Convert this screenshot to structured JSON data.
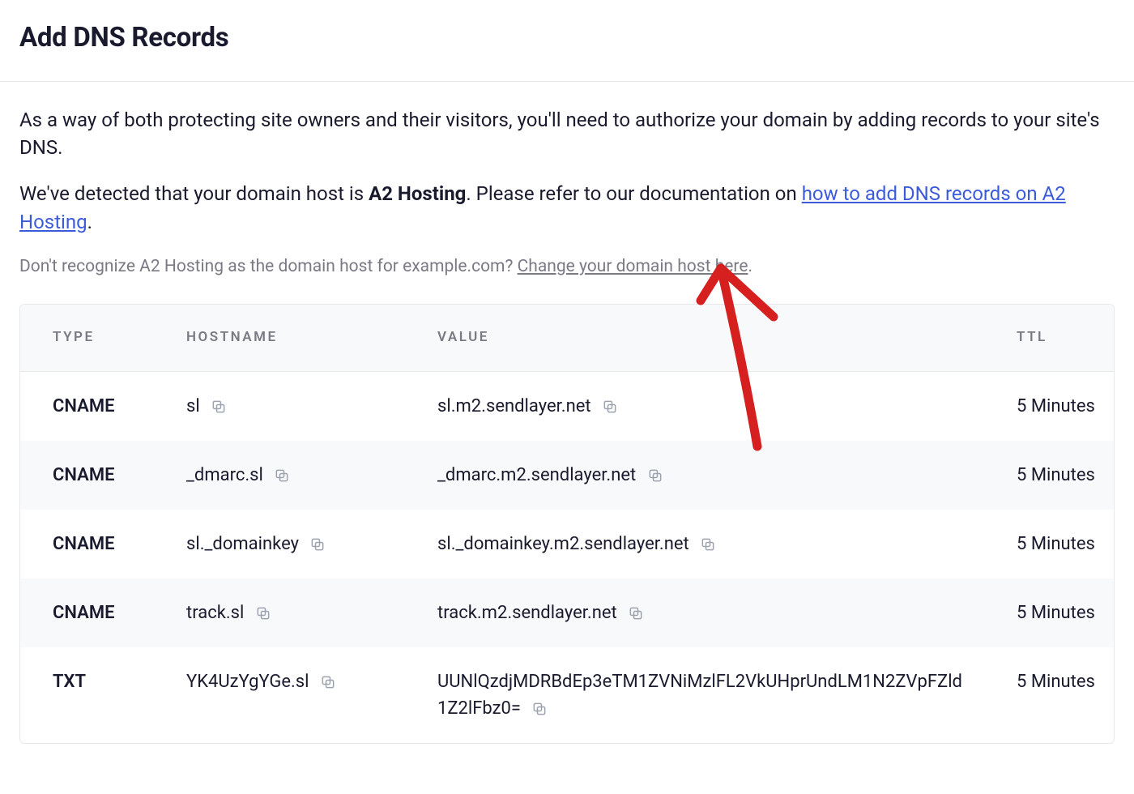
{
  "page": {
    "title": "Add DNS Records"
  },
  "intro": {
    "p1": "As a way of both protecting site owners and their visitors, you'll need to authorize your domain by adding records to your site's DNS.",
    "p2_prefix": "We've detected that your domain host is ",
    "p2_host": "A2 Hosting",
    "p2_mid": ". Please refer to our documentation on ",
    "p2_link": "how to add DNS records on A2 Hosting",
    "p2_suffix": ".",
    "unrecognized_prefix": "Don't recognize A2 Hosting as the domain host for example.com? ",
    "unrecognized_link": "Change your domain host here",
    "unrecognized_suffix": "."
  },
  "table": {
    "headers": {
      "type": "TYPE",
      "hostname": "HOSTNAME",
      "value": "VALUE",
      "ttl": "TTL"
    },
    "rows": [
      {
        "type": "CNAME",
        "hostname": "sl",
        "value": "sl.m2.sendlayer.net",
        "ttl": "5 Minutes"
      },
      {
        "type": "CNAME",
        "hostname": "_dmarc.sl",
        "value": "_dmarc.m2.sendlayer.net",
        "ttl": "5 Minutes"
      },
      {
        "type": "CNAME",
        "hostname": "sl._domainkey",
        "value": "sl._domainkey.m2.sendlayer.net",
        "ttl": "5 Minutes"
      },
      {
        "type": "CNAME",
        "hostname": "track.sl",
        "value": "track.m2.sendlayer.net",
        "ttl": "5 Minutes"
      },
      {
        "type": "TXT",
        "hostname": "YK4UzYgYGe.sl",
        "value": "UUNlQzdjMDRBdEp3eTM1ZVNiMzlFL2VkUHprUndLM1N2ZVpFZld1Z2lFbz0=",
        "ttl": "5 Minutes"
      }
    ]
  },
  "colors": {
    "link": "#3b5bdb",
    "muted": "#7a7a85",
    "border": "#e6e8ec",
    "row_alt": "#f8f9fb",
    "annotation": "#d61f1f"
  }
}
